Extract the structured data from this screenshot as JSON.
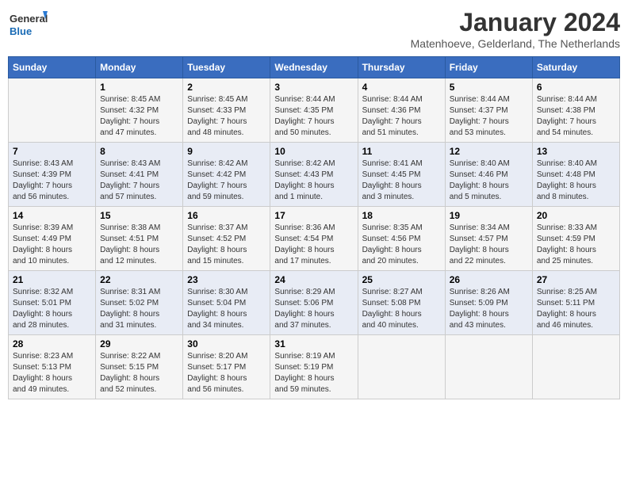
{
  "header": {
    "logo_line1": "General",
    "logo_line2": "Blue",
    "month": "January 2024",
    "location": "Matenhoeve, Gelderland, The Netherlands"
  },
  "days_of_week": [
    "Sunday",
    "Monday",
    "Tuesday",
    "Wednesday",
    "Thursday",
    "Friday",
    "Saturday"
  ],
  "weeks": [
    [
      {
        "day": "",
        "info": ""
      },
      {
        "day": "1",
        "info": "Sunrise: 8:45 AM\nSunset: 4:32 PM\nDaylight: 7 hours\nand 47 minutes."
      },
      {
        "day": "2",
        "info": "Sunrise: 8:45 AM\nSunset: 4:33 PM\nDaylight: 7 hours\nand 48 minutes."
      },
      {
        "day": "3",
        "info": "Sunrise: 8:44 AM\nSunset: 4:35 PM\nDaylight: 7 hours\nand 50 minutes."
      },
      {
        "day": "4",
        "info": "Sunrise: 8:44 AM\nSunset: 4:36 PM\nDaylight: 7 hours\nand 51 minutes."
      },
      {
        "day": "5",
        "info": "Sunrise: 8:44 AM\nSunset: 4:37 PM\nDaylight: 7 hours\nand 53 minutes."
      },
      {
        "day": "6",
        "info": "Sunrise: 8:44 AM\nSunset: 4:38 PM\nDaylight: 7 hours\nand 54 minutes."
      }
    ],
    [
      {
        "day": "7",
        "info": "Sunrise: 8:43 AM\nSunset: 4:39 PM\nDaylight: 7 hours\nand 56 minutes."
      },
      {
        "day": "8",
        "info": "Sunrise: 8:43 AM\nSunset: 4:41 PM\nDaylight: 7 hours\nand 57 minutes."
      },
      {
        "day": "9",
        "info": "Sunrise: 8:42 AM\nSunset: 4:42 PM\nDaylight: 7 hours\nand 59 minutes."
      },
      {
        "day": "10",
        "info": "Sunrise: 8:42 AM\nSunset: 4:43 PM\nDaylight: 8 hours\nand 1 minute."
      },
      {
        "day": "11",
        "info": "Sunrise: 8:41 AM\nSunset: 4:45 PM\nDaylight: 8 hours\nand 3 minutes."
      },
      {
        "day": "12",
        "info": "Sunrise: 8:40 AM\nSunset: 4:46 PM\nDaylight: 8 hours\nand 5 minutes."
      },
      {
        "day": "13",
        "info": "Sunrise: 8:40 AM\nSunset: 4:48 PM\nDaylight: 8 hours\nand 8 minutes."
      }
    ],
    [
      {
        "day": "14",
        "info": "Sunrise: 8:39 AM\nSunset: 4:49 PM\nDaylight: 8 hours\nand 10 minutes."
      },
      {
        "day": "15",
        "info": "Sunrise: 8:38 AM\nSunset: 4:51 PM\nDaylight: 8 hours\nand 12 minutes."
      },
      {
        "day": "16",
        "info": "Sunrise: 8:37 AM\nSunset: 4:52 PM\nDaylight: 8 hours\nand 15 minutes."
      },
      {
        "day": "17",
        "info": "Sunrise: 8:36 AM\nSunset: 4:54 PM\nDaylight: 8 hours\nand 17 minutes."
      },
      {
        "day": "18",
        "info": "Sunrise: 8:35 AM\nSunset: 4:56 PM\nDaylight: 8 hours\nand 20 minutes."
      },
      {
        "day": "19",
        "info": "Sunrise: 8:34 AM\nSunset: 4:57 PM\nDaylight: 8 hours\nand 22 minutes."
      },
      {
        "day": "20",
        "info": "Sunrise: 8:33 AM\nSunset: 4:59 PM\nDaylight: 8 hours\nand 25 minutes."
      }
    ],
    [
      {
        "day": "21",
        "info": "Sunrise: 8:32 AM\nSunset: 5:01 PM\nDaylight: 8 hours\nand 28 minutes."
      },
      {
        "day": "22",
        "info": "Sunrise: 8:31 AM\nSunset: 5:02 PM\nDaylight: 8 hours\nand 31 minutes."
      },
      {
        "day": "23",
        "info": "Sunrise: 8:30 AM\nSunset: 5:04 PM\nDaylight: 8 hours\nand 34 minutes."
      },
      {
        "day": "24",
        "info": "Sunrise: 8:29 AM\nSunset: 5:06 PM\nDaylight: 8 hours\nand 37 minutes."
      },
      {
        "day": "25",
        "info": "Sunrise: 8:27 AM\nSunset: 5:08 PM\nDaylight: 8 hours\nand 40 minutes."
      },
      {
        "day": "26",
        "info": "Sunrise: 8:26 AM\nSunset: 5:09 PM\nDaylight: 8 hours\nand 43 minutes."
      },
      {
        "day": "27",
        "info": "Sunrise: 8:25 AM\nSunset: 5:11 PM\nDaylight: 8 hours\nand 46 minutes."
      }
    ],
    [
      {
        "day": "28",
        "info": "Sunrise: 8:23 AM\nSunset: 5:13 PM\nDaylight: 8 hours\nand 49 minutes."
      },
      {
        "day": "29",
        "info": "Sunrise: 8:22 AM\nSunset: 5:15 PM\nDaylight: 8 hours\nand 52 minutes."
      },
      {
        "day": "30",
        "info": "Sunrise: 8:20 AM\nSunset: 5:17 PM\nDaylight: 8 hours\nand 56 minutes."
      },
      {
        "day": "31",
        "info": "Sunrise: 8:19 AM\nSunset: 5:19 PM\nDaylight: 8 hours\nand 59 minutes."
      },
      {
        "day": "",
        "info": ""
      },
      {
        "day": "",
        "info": ""
      },
      {
        "day": "",
        "info": ""
      }
    ]
  ]
}
